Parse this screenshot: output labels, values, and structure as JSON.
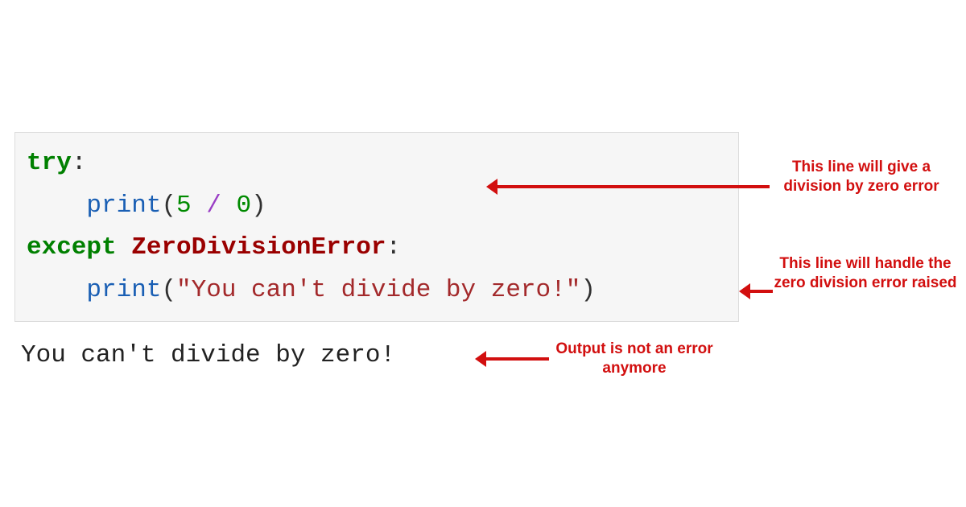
{
  "code": {
    "line1": {
      "kw": "try",
      "colon": ":"
    },
    "line2": {
      "indent": "    ",
      "fn": "print",
      "lp": "(",
      "n1": "5",
      "sp1": " ",
      "op": "/",
      "sp2": " ",
      "n2": "0",
      "rp": ")"
    },
    "line3": {
      "kw": "except",
      "sp": " ",
      "err": "ZeroDivisionError",
      "colon": ":"
    },
    "line4": {
      "indent": "    ",
      "fn": "print",
      "lp": "(",
      "str": "\"You can't divide by zero!\"",
      "rp": ")"
    }
  },
  "output": "You can't divide by zero!",
  "annotations": {
    "a1": "This line will give a division by zero error",
    "a2": "This line will handle the zero division error raised",
    "a3": "Output is not an error anymore"
  }
}
